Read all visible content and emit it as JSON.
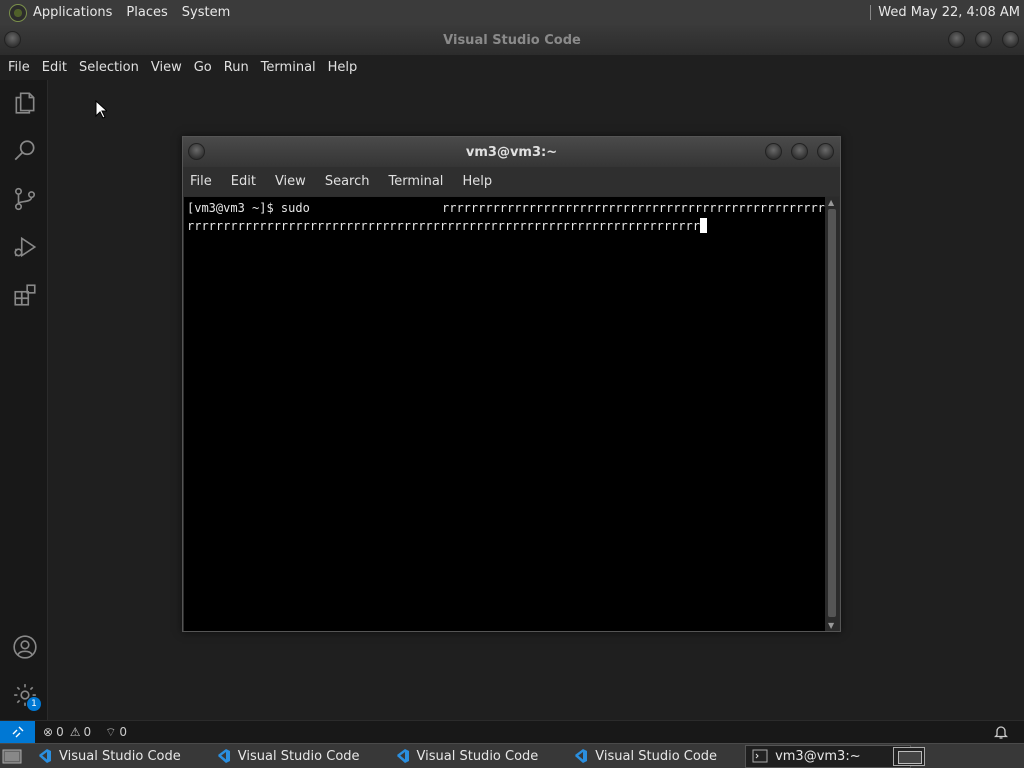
{
  "top_panel": {
    "menus": [
      "Applications",
      "Places",
      "System"
    ],
    "clock": "Wed May 22,  4:08 AM"
  },
  "vscode": {
    "window_title": "Visual Studio Code",
    "menu": [
      "File",
      "Edit",
      "Selection",
      "View",
      "Go",
      "Run",
      "Terminal",
      "Help"
    ],
    "activity_icons": [
      "explorer-icon",
      "search-icon",
      "source-control-icon",
      "run-debug-icon",
      "extensions-icon"
    ],
    "bottom_icons": [
      "account-icon",
      "settings-gear-icon"
    ],
    "settings_badge": "1",
    "status": {
      "errors": "0",
      "warnings": "0",
      "ports": "0"
    }
  },
  "terminal": {
    "title": "vm3@vm3:~",
    "menu": [
      "File",
      "Edit",
      "View",
      "Search",
      "Terminal",
      "Help"
    ],
    "line1_prompt": "[vm3@vm3 ~]$ sudo",
    "line1_rest": "rrrrrrrrrrrrrrrrrrrrrrrrrrrrrrrrrrrrrrrrrrrrrrrrrrrrrr",
    "line2": "rrrrrrrrrrrrrrrrrrrrrrrrrrrrrrrrrrrrrrrrrrrrrrrrrrrrrrrrrrrrrrrrrrrrrrr"
  },
  "taskbar": {
    "tasks": [
      {
        "label": "Visual Studio Code",
        "icon": "vscode-icon"
      },
      {
        "label": "Visual Studio Code",
        "icon": "vscode-icon"
      },
      {
        "label": "Visual Studio Code",
        "icon": "vscode-icon"
      },
      {
        "label": "Visual Studio Code",
        "icon": "vscode-icon"
      },
      {
        "label": "vm3@vm3:~",
        "icon": "terminal-icon"
      }
    ]
  },
  "colors": {
    "accent": "#0078d4",
    "terminal_bg": "#000000",
    "panel_bg": "#3b3b3b"
  }
}
